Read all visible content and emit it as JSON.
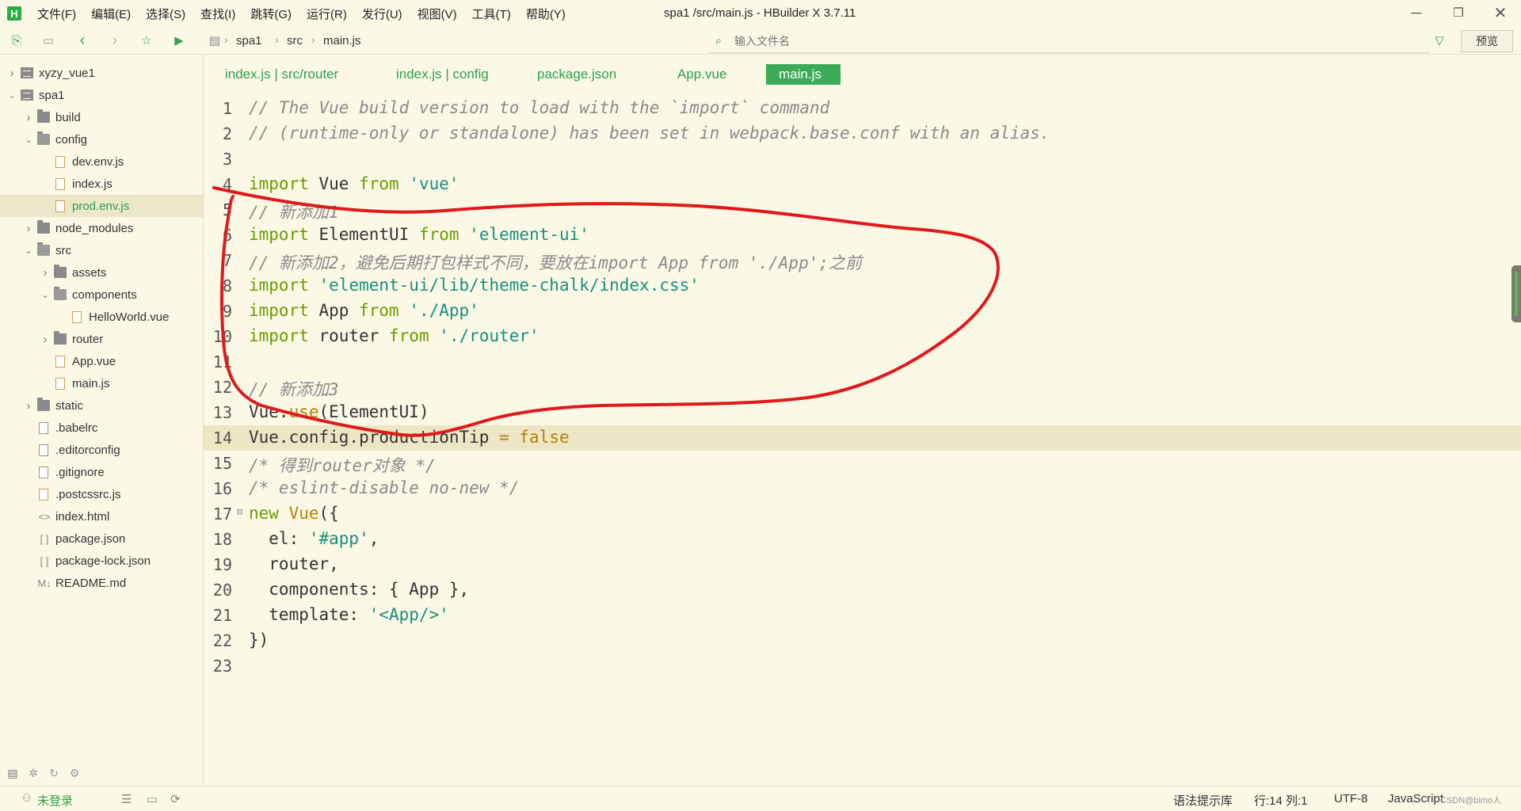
{
  "app": {
    "logo_letter": "H",
    "title": "spa1  /src/main.js - HBuilder X 3.7.11",
    "menu": [
      "文件(F)",
      "编辑(E)",
      "选择(S)",
      "查找(I)",
      "跳转(G)",
      "运行(R)",
      "发行(U)",
      "视图(V)",
      "工具(T)",
      "帮助(Y)"
    ]
  },
  "toolbar": {
    "breadcrumb": [
      "spa1",
      "src",
      "main.js"
    ],
    "search_placeholder": "输入文件名",
    "preview_label": "预览"
  },
  "sidebar": {
    "items": [
      {
        "label": "xyzy_vue1",
        "type": "project",
        "depth": 0,
        "expanded": false
      },
      {
        "label": "spa1",
        "type": "project",
        "depth": 0,
        "expanded": true
      },
      {
        "label": "build",
        "type": "folder",
        "depth": 1,
        "expanded": false
      },
      {
        "label": "config",
        "type": "folder",
        "depth": 1,
        "expanded": true
      },
      {
        "label": "dev.env.js",
        "type": "js",
        "depth": 2
      },
      {
        "label": "index.js",
        "type": "js",
        "depth": 2
      },
      {
        "label": "prod.env.js",
        "type": "js",
        "depth": 2,
        "selected": true
      },
      {
        "label": "node_modules",
        "type": "folder",
        "depth": 1,
        "expanded": false
      },
      {
        "label": "src",
        "type": "folder",
        "depth": 1,
        "expanded": true
      },
      {
        "label": "assets",
        "type": "folder",
        "depth": 2,
        "expanded": false
      },
      {
        "label": "components",
        "type": "folder",
        "depth": 2,
        "expanded": true
      },
      {
        "label": "HelloWorld.vue",
        "type": "vue",
        "depth": 3
      },
      {
        "label": "router",
        "type": "folder",
        "depth": 2,
        "expanded": false
      },
      {
        "label": "App.vue",
        "type": "vue",
        "depth": 2
      },
      {
        "label": "main.js",
        "type": "js",
        "depth": 2
      },
      {
        "label": "static",
        "type": "folder",
        "depth": 1,
        "expanded": false
      },
      {
        "label": ".babelrc",
        "type": "plain",
        "depth": 1
      },
      {
        "label": ".editorconfig",
        "type": "plain",
        "depth": 1
      },
      {
        "label": ".gitignore",
        "type": "plain",
        "depth": 1
      },
      {
        "label": ".postcssrc.js",
        "type": "js",
        "depth": 1
      },
      {
        "label": "index.html",
        "type": "html",
        "depth": 1
      },
      {
        "label": "package.json",
        "type": "json",
        "depth": 1
      },
      {
        "label": "package-lock.json",
        "type": "json",
        "depth": 1
      },
      {
        "label": "README.md",
        "type": "md",
        "depth": 1
      }
    ]
  },
  "tabs": [
    {
      "label": "index.js | src/router",
      "active": false
    },
    {
      "label": "index.js | config",
      "active": false
    },
    {
      "label": "package.json",
      "active": false
    },
    {
      "label": "App.vue",
      "active": false
    },
    {
      "label": "main.js",
      "active": true
    }
  ],
  "editor": {
    "current_line": 14,
    "lines": [
      [
        {
          "t": "// The Vue build version to load with the `import` command",
          "c": "comment"
        }
      ],
      [
        {
          "t": "// (runtime-only or standalone) has been set in webpack.base.conf with an alias.",
          "c": "comment"
        }
      ],
      [],
      [
        {
          "t": "import",
          "c": "kw"
        },
        {
          "t": " Vue ",
          "c": ""
        },
        {
          "t": "from",
          "c": "kw"
        },
        {
          "t": " ",
          "c": ""
        },
        {
          "t": "'vue'",
          "c": "str"
        }
      ],
      [
        {
          "t": "// 新添加1",
          "c": "comment"
        }
      ],
      [
        {
          "t": "import",
          "c": "kw"
        },
        {
          "t": " ElementUI ",
          "c": ""
        },
        {
          "t": "from",
          "c": "kw"
        },
        {
          "t": " ",
          "c": ""
        },
        {
          "t": "'element-ui'",
          "c": "str"
        }
      ],
      [
        {
          "t": "// 新添加2，避免后期打包样式不同，要放在import App from './App';之前",
          "c": "comment"
        }
      ],
      [
        {
          "t": "import",
          "c": "kw"
        },
        {
          "t": " ",
          "c": ""
        },
        {
          "t": "'element-ui/lib/theme-chalk/index.css'",
          "c": "str"
        }
      ],
      [
        {
          "t": "import",
          "c": "kw"
        },
        {
          "t": " App ",
          "c": ""
        },
        {
          "t": "from",
          "c": "kw"
        },
        {
          "t": " ",
          "c": ""
        },
        {
          "t": "'./App'",
          "c": "str"
        }
      ],
      [
        {
          "t": "import",
          "c": "kw"
        },
        {
          "t": " router ",
          "c": ""
        },
        {
          "t": "from",
          "c": "kw"
        },
        {
          "t": " ",
          "c": ""
        },
        {
          "t": "'./router'",
          "c": "str"
        }
      ],
      [],
      [
        {
          "t": "// 新添加3",
          "c": "comment"
        }
      ],
      [
        {
          "t": "Vue.",
          "c": ""
        },
        {
          "t": "use",
          "c": "call"
        },
        {
          "t": "(ElementUI)",
          "c": ""
        }
      ],
      [
        {
          "t": "Vue.config.productionTip ",
          "c": ""
        },
        {
          "t": "=",
          "c": "call"
        },
        {
          "t": " ",
          "c": ""
        },
        {
          "t": "false",
          "c": "call"
        }
      ],
      [
        {
          "t": "/* 得到router对象 */",
          "c": "comment"
        }
      ],
      [
        {
          "t": "/* eslint-disable no-new */",
          "c": "comment"
        }
      ],
      [
        {
          "t": "new",
          "c": "kw"
        },
        {
          "t": " ",
          "c": ""
        },
        {
          "t": "Vue",
          "c": "call"
        },
        {
          "t": "({",
          "c": ""
        }
      ],
      [
        {
          "t": "  el: ",
          "c": ""
        },
        {
          "t": "'#app'",
          "c": "str"
        },
        {
          "t": ",",
          "c": ""
        }
      ],
      [
        {
          "t": "  router,",
          "c": ""
        }
      ],
      [
        {
          "t": "  components: { App },",
          "c": ""
        }
      ],
      [
        {
          "t": "  template: ",
          "c": ""
        },
        {
          "t": "'<App/>'",
          "c": "str"
        }
      ],
      [
        {
          "t": "})",
          "c": ""
        }
      ],
      []
    ]
  },
  "statusbar": {
    "login": "未登录",
    "syntax_hint": "语法提示库",
    "position": "行:14  列:1",
    "encoding": "UTF-8",
    "language": "JavaScript",
    "watermark": "CSDN@bimo人"
  },
  "colors": {
    "accent": "#3aac56",
    "annotation": "#e0191b",
    "background": "#fbf8e6"
  }
}
